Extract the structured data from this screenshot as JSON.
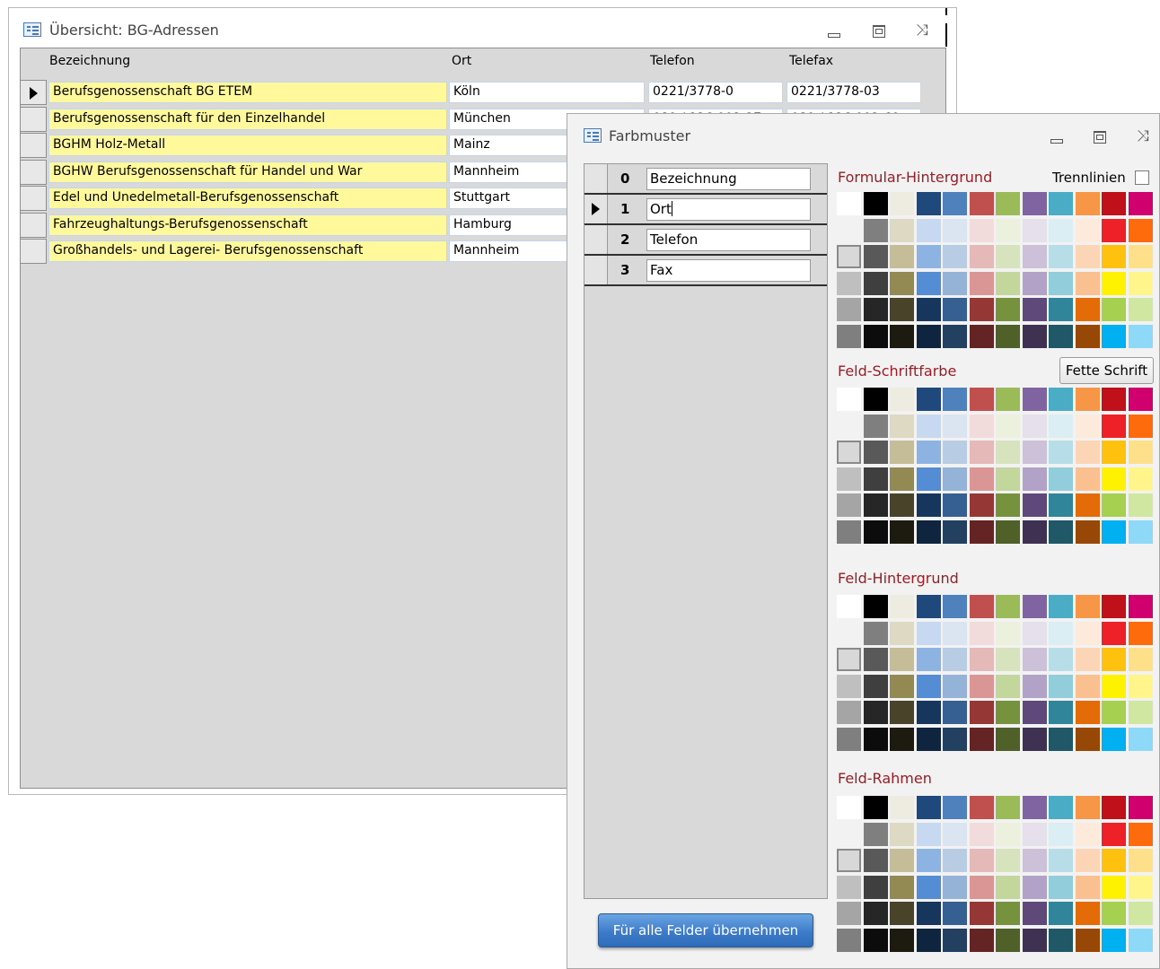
{
  "bg_window": {
    "title": "Übersicht: BG-Adressen",
    "columns": [
      "Bezeichnung",
      "Ort",
      "Telefon",
      "Telefax"
    ],
    "rows": [
      {
        "bezeichnung": "Berufsgenossenschaft BG ETEM",
        "ort": "Köln",
        "telefon": "0221/3778-0",
        "telefax": "0221/3778-03"
      },
      {
        "bezeichnung": "Berufsgenossenschaft für den Einzelhandel",
        "ort": "München",
        "telefon": "089 / 126 002-17",
        "telefax": "089 / 126 002-69"
      },
      {
        "bezeichnung": "BGHM Holz-Metall",
        "ort": "Mainz",
        "telefon": "",
        "telefax": ""
      },
      {
        "bezeichnung": "BGHW Berufsgenossenschaft für Handel und War",
        "ort": "Mannheim",
        "telefon": "",
        "telefax": ""
      },
      {
        "bezeichnung": "Edel und Unedelmetall-Berufsgenossenschaft",
        "ort": "Stuttgart",
        "telefon": "",
        "telefax": ""
      },
      {
        "bezeichnung": "Fahrzeughaltungs-Berufsgenossenschaft",
        "ort": "Hamburg",
        "telefon": "",
        "telefax": ""
      },
      {
        "bezeichnung": "Großhandels- und Lagerei- Berufsgenossenschaft",
        "ort": "Mannheim",
        "telefon": "",
        "telefax": ""
      }
    ],
    "current_row": 0
  },
  "fm_window": {
    "title": "Farbmuster",
    "fields": [
      {
        "num": "0",
        "name": "Bezeichnung"
      },
      {
        "num": "1",
        "name": "Ort"
      },
      {
        "num": "2",
        "name": "Telefon"
      },
      {
        "num": "3",
        "name": "Fax"
      }
    ],
    "current_field": 1,
    "sections": [
      {
        "label": "Formular-Hintergrund"
      },
      {
        "label": "Feld-Schriftfarbe"
      },
      {
        "label": "Feld-Hintergrund"
      },
      {
        "label": "Feld-Rahmen"
      }
    ],
    "trennlinien_label": "Trennlinien",
    "trennlinien_checked": false,
    "fette_schrift_label": "Fette Schrift",
    "apply_label": "Für alle Felder übernehmen"
  },
  "palette_colors": [
    [
      "#ffffff",
      "#000000",
      "#eeece1",
      "#1f497d",
      "#4f81bd",
      "#c0504d",
      "#9bbb59",
      "#8064a2",
      "#4bacc6",
      "#f79646",
      "#c0101a",
      "#d0006f"
    ],
    [
      "#f2f2f2",
      "#7f7f7f",
      "#ddd9c3",
      "#c6d9f0",
      "#dbe5f1",
      "#f2dcdb",
      "#ebf1dd",
      "#e5e0ec",
      "#dbeef3",
      "#fdeada",
      "#ee2028",
      "#fe6b0c"
    ],
    [
      "#d8d8d8",
      "#595959",
      "#c4bd97",
      "#8db3e2",
      "#b8cce4",
      "#e5b9b7",
      "#d7e3bc",
      "#ccc1d9",
      "#b7dde8",
      "#fbd5b5",
      "#fec10e",
      "#fee08a"
    ],
    [
      "#bfbfbf",
      "#3f3f3f",
      "#938953",
      "#548dd4",
      "#95b3d7",
      "#d99694",
      "#c3d69b",
      "#b2a2c7",
      "#92cddc",
      "#fac08f",
      "#fff200",
      "#fff58a"
    ],
    [
      "#a5a5a5",
      "#262626",
      "#494429",
      "#17365d",
      "#366092",
      "#953734",
      "#76923c",
      "#5f497a",
      "#31859b",
      "#e36c09",
      "#a6d04f",
      "#cfe7a0"
    ],
    [
      "#7f7f7f",
      "#0c0c0c",
      "#1d1b10",
      "#0f243e",
      "#244061",
      "#632423",
      "#4f6128",
      "#3f3151",
      "#205867",
      "#974806",
      "#00b0f0",
      "#8ed8f8"
    ]
  ],
  "palette_selected_row": 2,
  "palette_selected_col": 0
}
